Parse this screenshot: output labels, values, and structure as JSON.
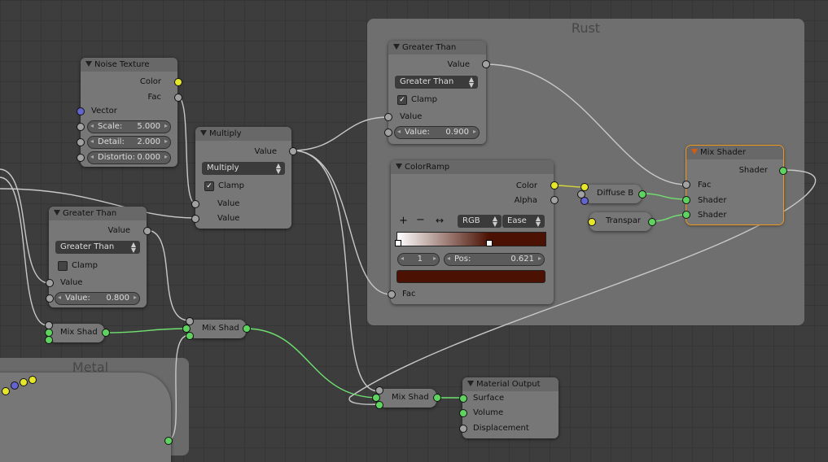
{
  "frames": {
    "rust": "Rust",
    "metal": "Metal"
  },
  "noise": {
    "title": "Noise Texture",
    "color": "Color",
    "fac": "Fac",
    "vector": "Vector",
    "scale_label": "Scale:",
    "scale_value": "5.000",
    "detail_label": "Detail:",
    "detail_value": "2.000",
    "distortion_label": "Distortio:",
    "distortion_value": "0.000"
  },
  "multiply": {
    "title": "Multiply",
    "out": "Value",
    "op": "Multiply",
    "clamp": "Clamp",
    "in1": "Value",
    "in2": "Value"
  },
  "gt_left": {
    "title": "Greater Than",
    "out": "Value",
    "op": "Greater Than",
    "clamp": "Clamp",
    "in1": "Value",
    "val_label": "Value:",
    "val": "0.800"
  },
  "gt_rust": {
    "title": "Greater Than",
    "out": "Value",
    "op": "Greater Than",
    "clamp": "Clamp",
    "in1": "Value",
    "val_label": "Value:",
    "val": "0.900"
  },
  "ramp": {
    "title": "ColorRamp",
    "color": "Color",
    "alpha": "Alpha",
    "plus": "+",
    "minus": "−",
    "flip": "↔",
    "mode": "RGB",
    "interp": "Ease",
    "index": "1",
    "pos_label": "Pos:",
    "pos": "0.621",
    "fac": "Fac",
    "stop_color": "#4b1103"
  },
  "diffuse": {
    "label": "Diffuse B"
  },
  "transp": {
    "label": "Transpar"
  },
  "mixshader": {
    "title": "Mix Shader",
    "out": "Shader",
    "fac": "Fac",
    "s1": "Shader",
    "s2": "Shader"
  },
  "mix_left": {
    "label": "Mix Shad"
  },
  "mix_mid": {
    "label": "Mix Shad"
  },
  "mix_bottom": {
    "label": "Mix Shad"
  },
  "output": {
    "title": "Material Output",
    "surface": "Surface",
    "volume": "Volume",
    "displacement": "Displacement"
  }
}
